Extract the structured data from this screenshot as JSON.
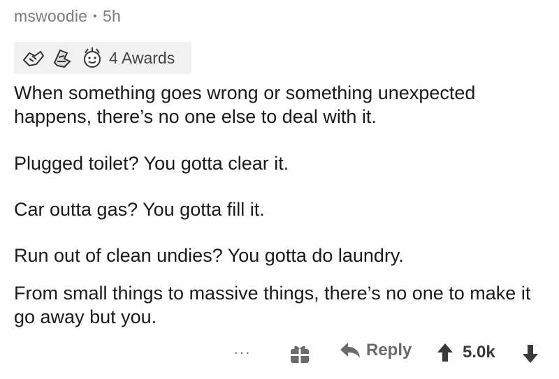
{
  "comment": {
    "author": "mswoodie",
    "separator": "•",
    "time_ago": "5h",
    "awards": {
      "icons": [
        "helpful-hands-icon",
        "wholesome-seal-icon",
        "wholesome-smiley-icon"
      ],
      "count_label": "4 Awards"
    },
    "paragraphs": [
      "When something goes wrong or something unexpected happens, there’s no one else to deal with it.",
      "Plugged toilet? You gotta clear it.",
      "Car outta gas? You gotta fill it.",
      "Run out of clean undies? You gotta do laundry.",
      "From small things to massive things, there’s no one to make it go away but you."
    ],
    "actions": {
      "more_label": "···",
      "reply_label": "Reply",
      "score": "5.0k"
    }
  },
  "colors": {
    "meta_text": "#7c7c7c",
    "awards_bg": "#f1f1f1",
    "body_text": "#1a1a1b",
    "action_gray": "#6b6b6b"
  }
}
